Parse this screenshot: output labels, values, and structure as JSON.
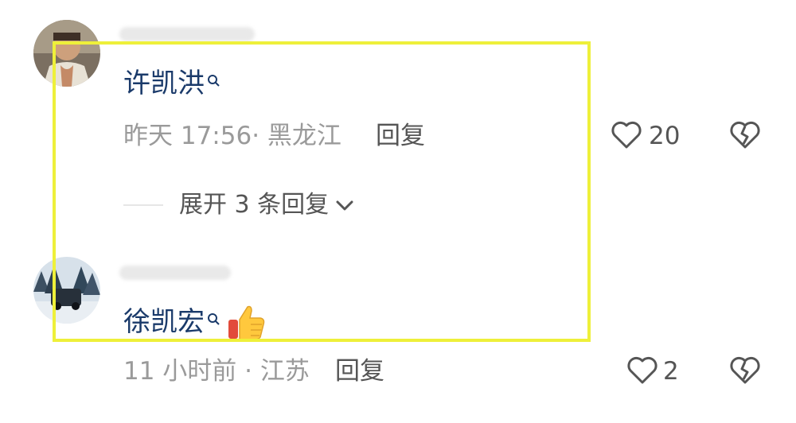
{
  "comments": [
    {
      "username": "许凯洪",
      "meta": "昨天 17:56· 黑龙江",
      "reply_label": "回复",
      "like_count": "20",
      "expand_label": "展开 3 条回复"
    },
    {
      "username": "徐凯宏",
      "meta": "11 小时前 · 江苏",
      "reply_label": "回复",
      "like_count": "2"
    }
  ],
  "icons": {
    "search_badge": "search-icon",
    "like": "heart-outline-icon",
    "dislike": "broken-heart-icon",
    "emoji": "thumbs-up-emoji",
    "chevron": "chevron-down-icon"
  },
  "colors": {
    "username": "#1a3a6a",
    "highlight_box": "#eef03a"
  }
}
